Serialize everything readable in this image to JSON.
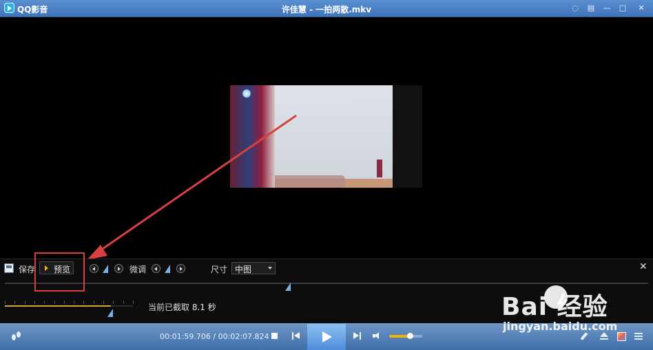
{
  "titlebar": {
    "app_name": "QQ影音",
    "window_title": "许佳慧 - 一拍两散.mkv",
    "buttons": [
      "chat-icon",
      "skin-icon",
      "minimize-icon",
      "maximize-icon",
      "close-icon"
    ]
  },
  "edit_panel": {
    "save_label": "保存",
    "preview_label": "预览",
    "fine_tune_label": "微调",
    "size_label": "尺寸",
    "size_value": "中图",
    "capture_prefix": "当前已截取",
    "capture_value": "8.1 秒",
    "close_symbol": "✕"
  },
  "controls": {
    "time_current": "00:01:59.706",
    "time_total": "00:02:07.824",
    "time_separator": "/",
    "volume_level": 0.62
  },
  "fine_scale": {
    "progress": 0.83
  },
  "watermark": {
    "text": "Bai  经验",
    "url": "jingyan.baidu.com"
  },
  "colors": {
    "titlebar": "#4a80c4",
    "annotation": "#d94040",
    "accent_play": "#f0b400"
  }
}
